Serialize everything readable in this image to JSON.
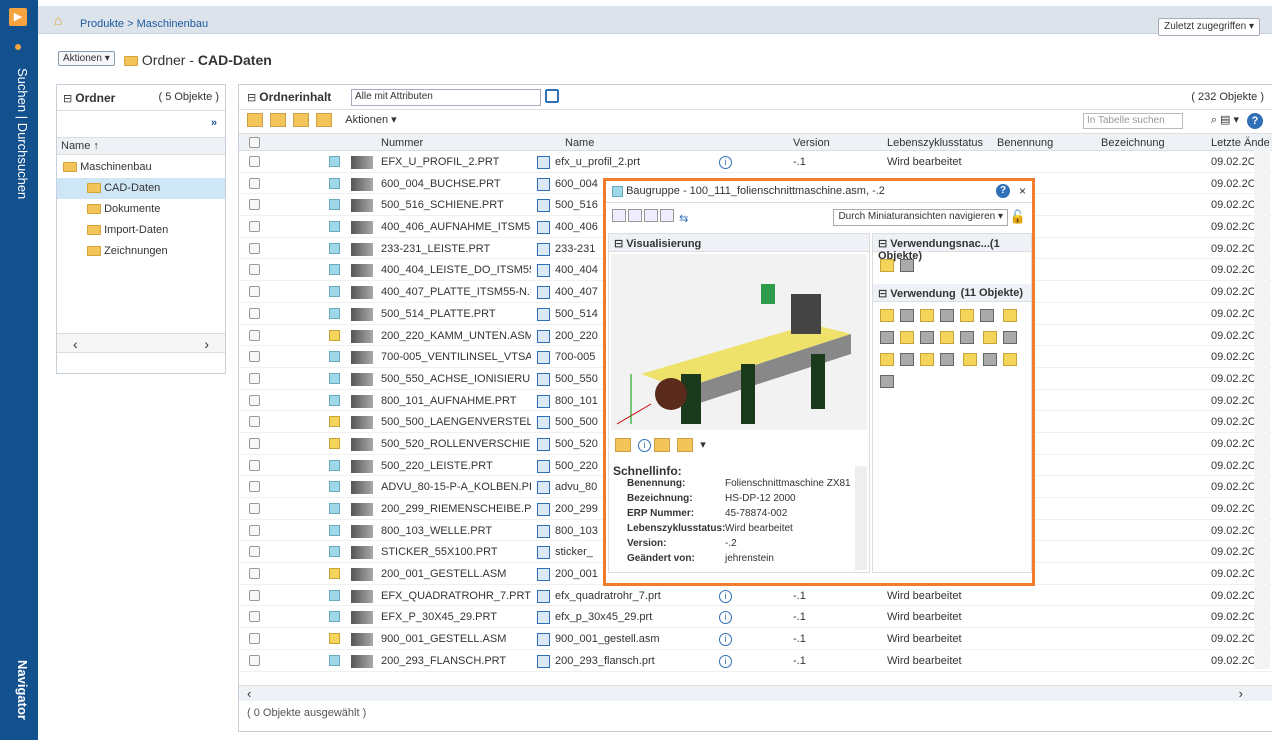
{
  "sidebar": {
    "search_label": "Suchen | Durchsuchen",
    "nav_label": "Navigator",
    "logo": "navigator-logo-icon"
  },
  "topbar": {
    "breadcrumb": "Produkte > Maschinenbau",
    "recent_label": "Zuletzt zugegriffen ▾"
  },
  "titlebar": {
    "actions_label": "Aktionen ▾",
    "title_prefix": "Ordner - ",
    "title_bold": "CAD-Daten"
  },
  "folders": {
    "header": "Ordner",
    "count": "( 5 Objekte )",
    "expand": "»",
    "col_name": "Name ↑",
    "items": [
      {
        "label": "Maschinenbau",
        "level": 0
      },
      {
        "label": "CAD-Daten",
        "level": 1
      },
      {
        "label": "Dokumente",
        "level": 1
      },
      {
        "label": "Import-Daten",
        "level": 1
      },
      {
        "label": "Zeichnungen",
        "level": 1
      }
    ]
  },
  "content": {
    "header": "Ordnerinhalt",
    "attr_select": "Alle mit Attributen",
    "count": "( 232 Objekte )",
    "actions_label": "Aktionen ▾",
    "search_placeholder": "In Tabelle suchen",
    "status": "( 0 Objekte ausgewählt )",
    "columns": {
      "nummer": "Nummer",
      "name": "Name",
      "version": "Version",
      "lifecycle": "Lebenszyklusstatus",
      "benennung": "Benennung",
      "bezeichnung": "Bezeichnung",
      "changed": "Letzte Ände"
    },
    "rows": [
      {
        "nummer": "EFX_U_PROFIL_2.PRT",
        "name": "efx_u_profil_2.prt",
        "version": "-.1",
        "status": "Wird bearbeitet",
        "date": "09.02.2C",
        "type": "part"
      },
      {
        "nummer": "600_004_BUCHSE.PRT",
        "name": "600_004",
        "version": "",
        "status": "",
        "date": "09.02.2C",
        "type": "part"
      },
      {
        "nummer": "500_516_SCHIENE.PRT",
        "name": "500_516",
        "version": "",
        "status": "",
        "date": "09.02.2C",
        "type": "part"
      },
      {
        "nummer": "400_406_AUFNAHME_ITSM55-N....",
        "name": "400_406",
        "version": "",
        "status": "",
        "date": "09.02.2C",
        "type": "part"
      },
      {
        "nummer": "233-231_LEISTE.PRT",
        "name": "233-231",
        "version": "",
        "status": "",
        "date": "09.02.2C",
        "type": "part"
      },
      {
        "nummer": "400_404_LEISTE_DO_ITSM55_N.PRT",
        "name": "400_404",
        "version": "",
        "status": "",
        "date": "09.02.2C",
        "type": "part"
      },
      {
        "nummer": "400_407_PLATTE_ITSM55-N.PRT",
        "name": "400_407",
        "version": "",
        "status": "",
        "date": "09.02.2C",
        "type": "part"
      },
      {
        "nummer": "500_514_PLATTE.PRT",
        "name": "500_514",
        "version": "",
        "status": "",
        "date": "09.02.2C",
        "type": "part"
      },
      {
        "nummer": "200_220_KAMM_UNTEN.ASM",
        "name": "200_220",
        "version": "",
        "status": "",
        "date": "09.02.2C",
        "type": "asm"
      },
      {
        "nummer": "700-005_VENTILINSEL_VTSA.PRT",
        "name": "700-005",
        "version": "",
        "status": "",
        "date": "09.02.2C",
        "type": "part"
      },
      {
        "nummer": "500_550_ACHSE_IONISIERUNG.PRT",
        "name": "500_550",
        "version": "",
        "status": "",
        "date": "09.02.2C",
        "type": "part"
      },
      {
        "nummer": "800_101_AUFNAHME.PRT",
        "name": "800_101",
        "version": "",
        "status": "",
        "date": "09.02.2C",
        "type": "part"
      },
      {
        "nummer": "500_500_LAENGENVERSTELLUNG....",
        "name": "500_500",
        "version": "",
        "status": "",
        "date": "09.02.2C",
        "type": "asm"
      },
      {
        "nummer": "500_520_ROLLENVERSCHIEBUNG....",
        "name": "500_520",
        "version": "",
        "status": "",
        "date": "09.02.2C",
        "type": "asm"
      },
      {
        "nummer": "500_220_LEISTE.PRT",
        "name": "500_220",
        "version": "",
        "status": "",
        "date": "09.02.2C",
        "type": "part"
      },
      {
        "nummer": "ADVU_80-15-P-A_KOLBEN.PRT",
        "name": "advu_80",
        "version": "",
        "status": "",
        "date": "09.02.2C",
        "type": "part"
      },
      {
        "nummer": "200_299_RIEMENSCHEIBE.PRT",
        "name": "200_299",
        "version": "",
        "status": "",
        "date": "09.02.2C",
        "type": "part"
      },
      {
        "nummer": "800_103_WELLE.PRT",
        "name": "800_103",
        "version": "",
        "status": "",
        "date": "09.02.2C",
        "type": "part"
      },
      {
        "nummer": "STICKER_55X100.PRT",
        "name": "sticker_",
        "version": "",
        "status": "",
        "date": "09.02.2C",
        "type": "part"
      },
      {
        "nummer": "200_001_GESTELL.ASM",
        "name": "200_001",
        "version": "",
        "status": "",
        "date": "09.02.2C",
        "type": "asm"
      },
      {
        "nummer": "EFX_QUADRATROHR_7.PRT",
        "name": "efx_quadratrohr_7.prt",
        "version": "-.1",
        "status": "Wird bearbeitet",
        "date": "09.02.2C",
        "type": "part"
      },
      {
        "nummer": "EFX_P_30X45_29.PRT",
        "name": "efx_p_30x45_29.prt",
        "version": "-.1",
        "status": "Wird bearbeitet",
        "date": "09.02.2C",
        "type": "part"
      },
      {
        "nummer": "900_001_GESTELL.ASM",
        "name": "900_001_gestell.asm",
        "version": "-.1",
        "status": "Wird bearbeitet",
        "date": "09.02.2C",
        "type": "asm"
      },
      {
        "nummer": "200_293_FLANSCH.PRT",
        "name": "200_293_flansch.prt",
        "version": "-.1",
        "status": "Wird bearbeitet",
        "date": "09.02.2C",
        "type": "part"
      }
    ]
  },
  "popup": {
    "title": "Baugruppe - 100_111_folienschnittmaschine.asm, -.2",
    "close": "×",
    "help": "?",
    "nav_select": "Durch Miniaturansichten navigieren ▾",
    "vis_header": "Visualisierung",
    "usage_ref_header": "Verwendungsnac...(1 Objekte)",
    "usage_header": "Verwendung",
    "usage_count": "(11 Objekte)",
    "quickinfo_title": "Schnellinfo:",
    "quickinfo": [
      {
        "k": "Benennung:",
        "v": "Folienschnittmaschine ZX81"
      },
      {
        "k": "Bezeichnung:",
        "v": "HS-DP-12 2000"
      },
      {
        "k": "ERP Nummer:",
        "v": "45-78874-002"
      },
      {
        "k": "Lebenszyklusstatus:",
        "v": "Wird bearbeitet"
      },
      {
        "k": "Version:",
        "v": "-.2"
      },
      {
        "k": "Geändert von:",
        "v": "jehrenstein"
      }
    ]
  }
}
